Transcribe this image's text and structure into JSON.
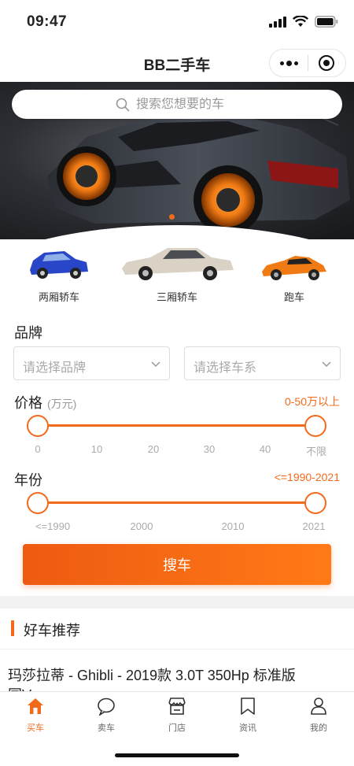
{
  "status": {
    "time": "09:47"
  },
  "nav": {
    "title": "BB二手车"
  },
  "search": {
    "placeholder": "搜索您想要的车"
  },
  "car_types": [
    {
      "label": "两厢轿车",
      "color": "#2a46c8"
    },
    {
      "label": "三厢轿车",
      "color": "#d9d2c5"
    },
    {
      "label": "跑车",
      "color": "#f07a14"
    }
  ],
  "brand": {
    "title": "品牌",
    "brand_placeholder": "请选择品牌",
    "series_placeholder": "请选择车系"
  },
  "price": {
    "title": "价格",
    "unit": "(万元)",
    "range_text": "0-50万以上",
    "ticks": [
      "0",
      "10",
      "20",
      "30",
      "40",
      "不限"
    ],
    "selected_min": "0",
    "selected_max": "不限"
  },
  "year": {
    "title": "年份",
    "range_text": "<=1990-2021",
    "ticks": [
      "<=1990",
      "2000",
      "2010",
      "2021"
    ],
    "selected_min": "<=1990",
    "selected_max": "2021"
  },
  "search_button": {
    "label": "搜车"
  },
  "recommend": {
    "title": "好车推荐",
    "first_item": "玛莎拉蒂 - Ghibli - 2019款 3.0T 350Hp 标准版",
    "first_item_wrap": "国V"
  },
  "tabs": [
    {
      "label": "买车",
      "icon": "home-icon",
      "active": true
    },
    {
      "label": "卖车",
      "icon": "chat-bubble-icon",
      "active": false
    },
    {
      "label": "门店",
      "icon": "store-icon",
      "active": false
    },
    {
      "label": "资讯",
      "icon": "bookmark-icon",
      "active": false
    },
    {
      "label": "我的",
      "icon": "user-icon",
      "active": false
    }
  ],
  "colors": {
    "accent": "#f26a1b",
    "text": "#222222",
    "muted": "#999999"
  }
}
